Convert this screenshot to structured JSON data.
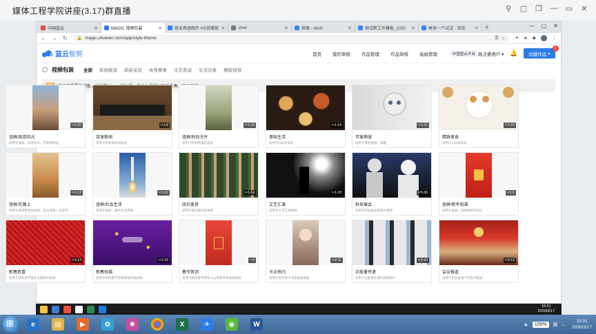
{
  "meeting": {
    "title": "媒体工程学院讲座(3.17)群直播"
  },
  "browser": {
    "tabs": [
      {
        "label": "中国蓝云",
        "color": "#e04b3c",
        "active": false
      },
      {
        "label": "MAGIC 视频包装",
        "color": "#2b7de9",
        "active": true
      },
      {
        "label": "商业用途图片 HS页面部",
        "color": "#3b82f6",
        "active": false
      },
      {
        "label": "Jove",
        "color": "#777777",
        "active": false
      },
      {
        "label": "检索 - MAH",
        "color": "#3b82f6",
        "active": false
      },
      {
        "label": "测试新工作模板_2020",
        "color": "#3b82f6",
        "active": false
      },
      {
        "label": "再来一个试试 - 浏览",
        "color": "#3b82f6",
        "active": false
      }
    ],
    "url": "magic.shuwen.com/app/style-theme"
  },
  "site": {
    "logo_a": "蓝云",
    "logo_b": "智剪",
    "nav": [
      "首页",
      "我的审核",
      "作品管理",
      "作品审核",
      "高级管理"
    ],
    "brand_tag": "中国蓝云平台",
    "user": "政法委用户",
    "create_label": "创建作品",
    "badge": "1"
  },
  "category": {
    "title": "视频包装",
    "items": [
      "全部",
      "新闻报道",
      "新新采风",
      "体育赛事",
      "文艺表演",
      "生活记录",
      "赛版视频"
    ],
    "active_index": 0
  },
  "tip": {
    "badge": "TIP",
    "text": "选择您需要的模板，填充素材，一键生成，自动为您配好音乐节奏、转场特效。"
  },
  "templates": [
    {
      "title": "竖屏/旅游风光",
      "desc": "适用于竖屏，旅游风光，节奏感较强",
      "dur": "1-25",
      "theme": "travel"
    },
    {
      "title": "突发新闻",
      "desc": "适用于突发类新闻报道",
      "dur": "1-8",
      "theme": "court"
    },
    {
      "title": "竖屏/时尚大片",
      "desc": "适用于时尚感强的竖屏",
      "dur": "1-23",
      "theme": "fashion"
    },
    {
      "title": "美味生活",
      "desc": "适用于vlog风美食",
      "dur": "1-14",
      "theme": "food"
    },
    {
      "title": "可爱萌宠",
      "desc": "适用于萌宠视频，搞趣",
      "dur": "1-21",
      "theme": "cat"
    },
    {
      "title": "精致美食",
      "desc": "适用于vlog风美食",
      "dur": "1-22",
      "theme": "cookie"
    },
    {
      "title": "竖屏/在路上",
      "desc": "适用于旅游等竖屏视频，复古风格，抖音等",
      "dur": "1-12",
      "theme": "desert"
    },
    {
      "title": "竖屏/社会生活",
      "desc": "适用于竖屏，展示生活风貌",
      "dur": "1-12",
      "theme": "rocket"
    },
    {
      "title": "阅兵鉴赏",
      "desc": "适用于阅兵展示类视频",
      "dur": "1-14",
      "theme": "parade"
    },
    {
      "title": "文艺汇演",
      "desc": "适用于文艺汇演视频",
      "dur": "1-18",
      "theme": "concert"
    },
    {
      "title": "科技展会",
      "desc": "适用于科技展会类图片集锦",
      "dur": "5-36",
      "theme": "robot"
    },
    {
      "title": "竖屏/新年祝福",
      "desc": "适用于竖屏，短视频新年快乐",
      "dur": "1-5",
      "theme": "newyear"
    },
    {
      "title": "新春贺喜",
      "desc": "适用于新年春节喜庆主题类的视频",
      "dur": "1-14",
      "theme": "redtex"
    },
    {
      "title": "新春祝福",
      "desc": "适用于制作春节新春祝福的短视频",
      "dur": "1-16",
      "theme": "purple"
    },
    {
      "title": "春节贺词",
      "desc": "适用于制作春节拜年Vlog等春节贺辞类视频",
      "dur": "2",
      "theme": "couplet"
    },
    {
      "title": "卡点快闪",
      "desc": "适用于快节奏卡点类展现模板",
      "dur": "2-11",
      "theme": "quick"
    },
    {
      "title": "正能量传递",
      "desc": "适用于正能量主题的新闻短片",
      "dur": "2-10",
      "theme": "masks"
    },
    {
      "title": "会议报道",
      "desc": "适用于会议报道下的宣传报道",
      "dur": "2-12",
      "theme": "hall"
    }
  ],
  "taskbar": {
    "zoom": "100%",
    "time": "15:31",
    "date": "2020/3/17"
  }
}
